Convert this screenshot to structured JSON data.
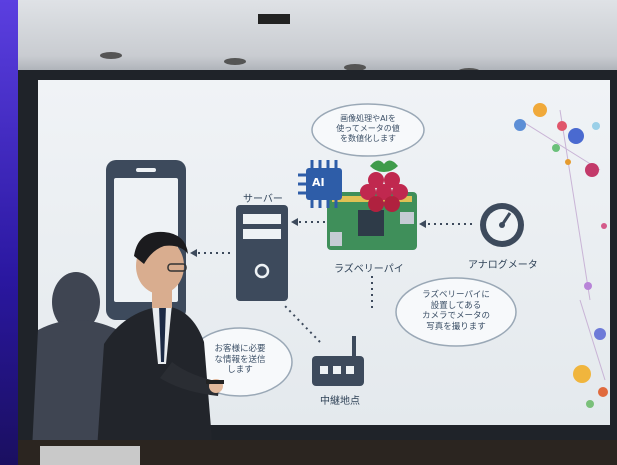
{
  "slide": {
    "bubble_top": "画像処理やAIを\n使ってメータの値\nを数値化します",
    "server_label": "サーバー",
    "raspberry_label": "ラズベリーパイ",
    "meter_label": "アナログメータ",
    "bubble_right": "ラズベリーパイに\n設置してある\nカメラでメータの\n写真を撮ります",
    "bubble_left": "お客様に必要\nな情報を送信\nします",
    "relay_label": "中継地点",
    "ai_chip_label": "AI"
  },
  "colors": {
    "screen": "#e9eef2",
    "ceiling": "#cfd3d8",
    "dark_icon": "#3d4a5c",
    "board_green": "#3f8f5a",
    "berry": "#c0284f",
    "left_wall": "#3a1fb0"
  }
}
